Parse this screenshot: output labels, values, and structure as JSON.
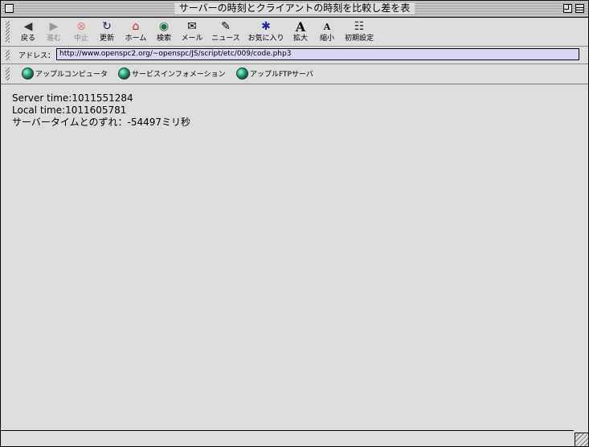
{
  "window": {
    "title": "サーバーの時刻とクライアントの時刻を比較し差を表"
  },
  "toolbar": {
    "buttons": [
      {
        "label": "戻る",
        "icon": "back-arrow-icon",
        "glyph": "◀"
      },
      {
        "label": "進む",
        "icon": "forward-arrow-icon",
        "glyph": "▶"
      },
      {
        "label": "中止",
        "icon": "stop-icon",
        "glyph": "⊗"
      },
      {
        "label": "更新",
        "icon": "refresh-icon",
        "glyph": "↻"
      },
      {
        "label": "ホーム",
        "icon": "home-icon",
        "glyph": "⌂"
      },
      {
        "label": "検索",
        "icon": "search-globe-icon",
        "glyph": "◉"
      },
      {
        "label": "メール",
        "icon": "mail-icon",
        "glyph": "✉"
      },
      {
        "label": "ニュース",
        "icon": "news-icon",
        "glyph": "✎"
      },
      {
        "label": "お気に入り",
        "icon": "favorites-icon",
        "glyph": "✱"
      },
      {
        "label": "拡大",
        "icon": "font-larger-icon",
        "glyph": "A"
      },
      {
        "label": "縮小",
        "icon": "font-smaller-icon",
        "glyph": "A"
      },
      {
        "label": "初期設定",
        "icon": "preferences-icon",
        "glyph": "☷"
      }
    ]
  },
  "address": {
    "label": "アドレス：",
    "url": "http://www.openspc2.org/~openspc/JS/script/etc/009/code.php3"
  },
  "favorites": {
    "items": [
      {
        "label": "アップルコンピュータ",
        "icon": "globe-icon"
      },
      {
        "label": "サービスインフォメーション",
        "icon": "globe-icon"
      },
      {
        "label": "アップルFTPサーバ",
        "icon": "globe-icon"
      }
    ]
  },
  "content": {
    "server_time": "Server time:1011551284",
    "local_time": "Local time:1011605781",
    "difference": "サーバータイムとのずれ：-54497ミリ秒"
  },
  "colors": {
    "window_bg": "#dddddd",
    "address_field_bg": "#d8d8f4",
    "stop_icon": "#e05050"
  }
}
